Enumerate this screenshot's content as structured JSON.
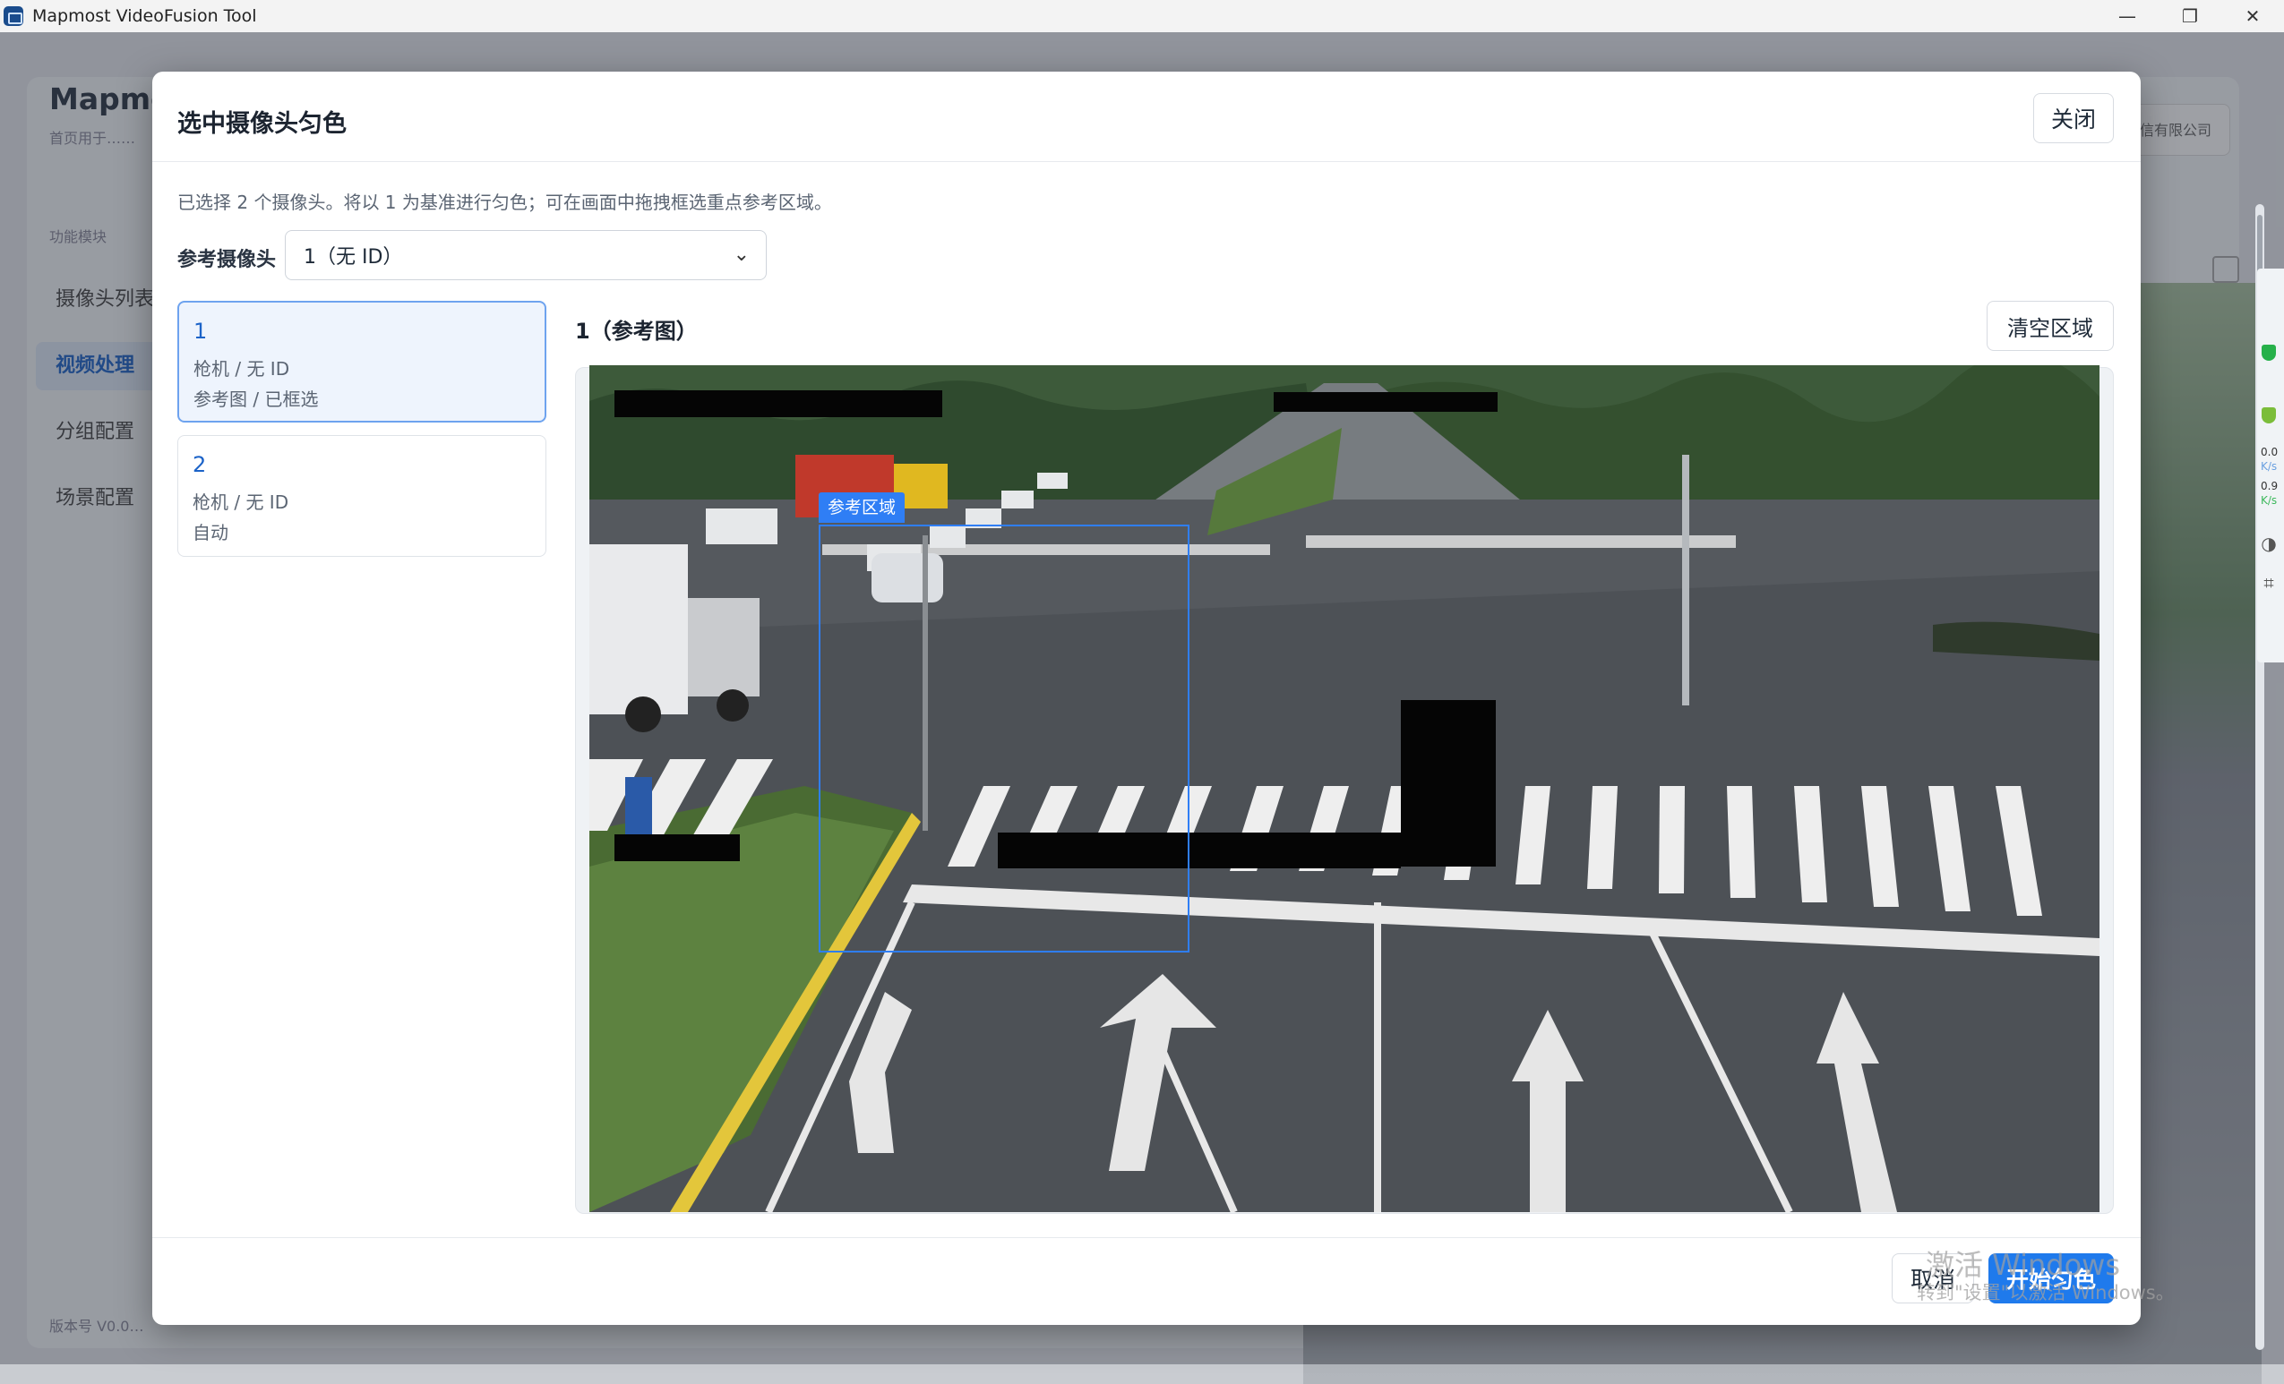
{
  "window": {
    "title": "Mapmost VideoFusion Tool",
    "controls": {
      "minimize": "—",
      "restore": "❐",
      "close": "✕"
    }
  },
  "background_app": {
    "brand": "Mapmo",
    "subtitle": "首页用于……",
    "group_label": "功能模块",
    "nav": [
      "摄像头列表",
      "视频处理",
      "分组配置",
      "场景配置"
    ],
    "active_nav_index": 1,
    "version": "版本号 V0.0…",
    "company": "…信有限公司"
  },
  "side_widget": {
    "up": "0.0",
    "up_unit": "K/s",
    "down": "0.9",
    "down_unit": "K/s"
  },
  "modal": {
    "title": "选中摄像头匀色",
    "close_label": "关闭",
    "hint": "已选择 2 个摄像头。将以 1 为基准进行匀色；可在画面中拖拽框选重点参考区域。",
    "reference_label": "参考摄像头",
    "reference_select_value": "1（无 ID）",
    "cameras": [
      {
        "number": "1",
        "type_id": "枪机 / 无 ID",
        "status": "参考图 / 已框选",
        "active": true
      },
      {
        "number": "2",
        "type_id": "枪机 / 无 ID",
        "status": "自动",
        "active": false
      }
    ],
    "preview_title": "1（参考图）",
    "clear_label": "清空区域",
    "region_tag": "参考区域",
    "cancel_label": "取消",
    "start_label": "开始匀色"
  },
  "watermark": {
    "line1": "激活 Windows",
    "line2": "转到\"设置\"以激活 Windows。"
  },
  "colors": {
    "accent": "#1f7aec",
    "selection": "#2f7ef5",
    "active_card_bg": "#eef4fd"
  },
  "icons": [
    "app-logo-icon",
    "minimize-icon",
    "restore-icon",
    "close-icon",
    "chevron-down-icon",
    "shield-icon",
    "expand-icon",
    "crop-icon",
    "swirl-icon"
  ]
}
